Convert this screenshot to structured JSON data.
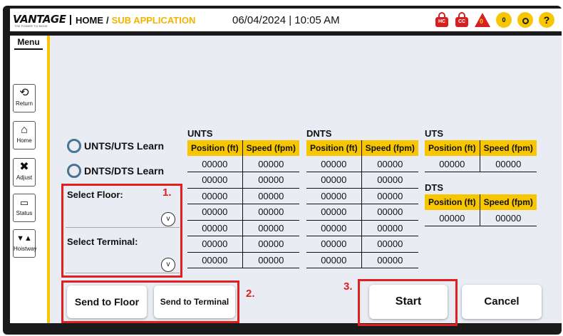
{
  "header": {
    "logo": "VANTAGE",
    "logo_tagline": "THE POWER TO MOVE",
    "home": "HOME",
    "separator": "/",
    "sub": "SUB APPLICATION",
    "datetime": "06/04/2024 | 10:05 AM",
    "icons": [
      {
        "name": "hc-lock-icon",
        "text": "HC",
        "color": "#d42020"
      },
      {
        "name": "cc-lock-icon",
        "text": "CC",
        "color": "#d42020"
      },
      {
        "name": "warning-icon",
        "text": "0",
        "color": "#d42020"
      },
      {
        "name": "alarm-clock-icon",
        "text": "0",
        "color": "#f7c600"
      },
      {
        "name": "search-icon",
        "text": "",
        "color": "#f7c600"
      },
      {
        "name": "help-icon",
        "text": "?",
        "color": "#f7c600"
      }
    ]
  },
  "sidebar": {
    "menu_label": "Menu",
    "items": [
      {
        "label": "Return",
        "icon": "return-icon"
      },
      {
        "label": "Home",
        "icon": "home-icon"
      },
      {
        "label": "Adjust",
        "icon": "tools-icon"
      },
      {
        "label": "Status",
        "icon": "status-icon"
      },
      {
        "label": "Hoistway",
        "icon": "hoistway-icon"
      }
    ]
  },
  "learn": {
    "option1": "UNTS/UTS Learn",
    "option2": "DNTS/DTS Learn"
  },
  "selectors": {
    "floor_label": "Select Floor:",
    "terminal_label": "Select Terminal:"
  },
  "notes": {
    "n1": "1.",
    "n2": "2.",
    "n3": "3."
  },
  "tables": {
    "col_position": "Position (ft)",
    "col_speed": "Speed (fpm)",
    "unts": {
      "title": "UNTS",
      "rows": [
        [
          "00000",
          "00000"
        ],
        [
          "00000",
          "00000"
        ],
        [
          "00000",
          "00000"
        ],
        [
          "00000",
          "00000"
        ],
        [
          "00000",
          "00000"
        ],
        [
          "00000",
          "00000"
        ],
        [
          "00000",
          "00000"
        ]
      ]
    },
    "dnts": {
      "title": "DNTS",
      "rows": [
        [
          "00000",
          "00000"
        ],
        [
          "00000",
          "00000"
        ],
        [
          "00000",
          "00000"
        ],
        [
          "00000",
          "00000"
        ],
        [
          "00000",
          "00000"
        ],
        [
          "00000",
          "00000"
        ],
        [
          "00000",
          "00000"
        ]
      ]
    },
    "uts": {
      "title": "UTS",
      "rows": [
        [
          "00000",
          "00000"
        ]
      ]
    },
    "dts": {
      "title": "DTS",
      "rows": [
        [
          "00000",
          "00000"
        ]
      ]
    }
  },
  "buttons": {
    "send_floor": "Send to Floor",
    "send_terminal": "Send to Terminal",
    "start": "Start",
    "cancel": "Cancel"
  },
  "colors": {
    "accent_yellow": "#f7c600",
    "sub_app_text": "#f2b400",
    "alert_red": "#d42020",
    "highlight_box": "#e02020",
    "background": "#e9ecf3"
  }
}
